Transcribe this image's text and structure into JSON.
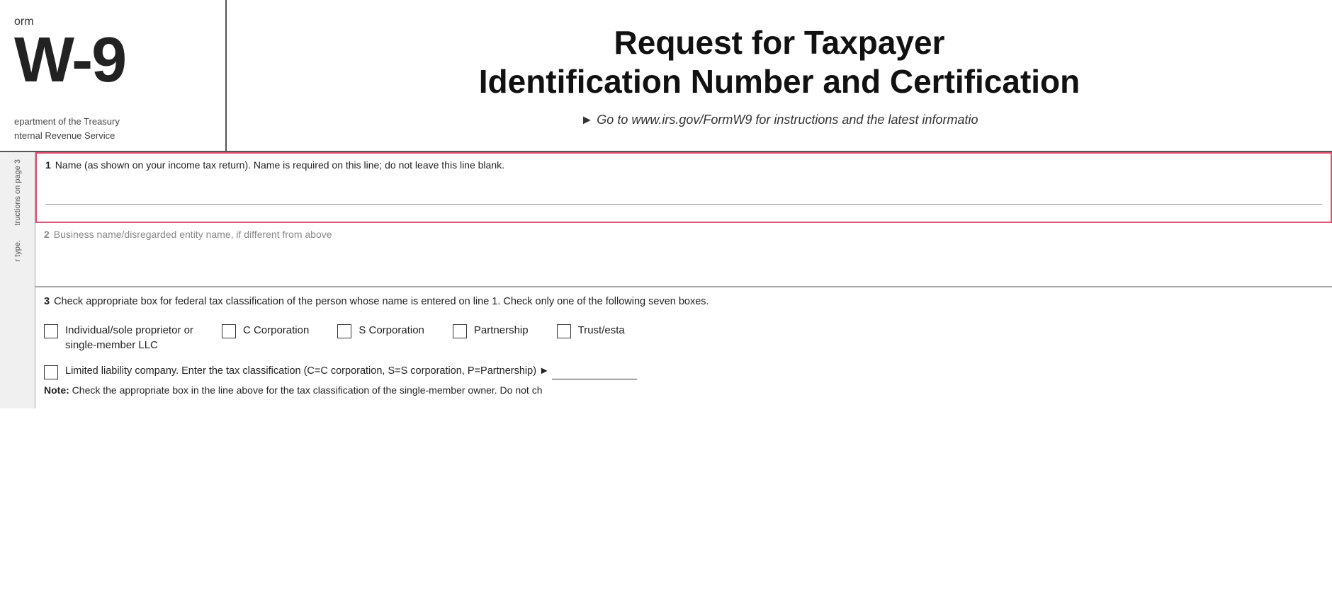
{
  "header": {
    "form_number": "W-9",
    "form_label": "orm",
    "dept_line1": "epartment of the Treasury",
    "dept_line2": "nternal Revenue Service",
    "title_line1": "Request for Taxpayer",
    "title_line2": "Identification Number and Certification",
    "url_text": "► Go to www.irs.gov/FormW9 for instructions and the latest informatio"
  },
  "sidebar": {
    "line1": "r type.",
    "line2": "tructions on page 3"
  },
  "field1": {
    "number": "1",
    "label": "Name (as shown on your income tax return). Name is required on this line; do not leave this line blank."
  },
  "field2": {
    "number": "2",
    "label": "Business name/disregarded entity name, if different from above"
  },
  "field3": {
    "number": "3",
    "header": "Check appropriate box for federal tax classification of the person whose name is entered on line 1. Check only one of the following seven boxes.",
    "checkbox1_label": "Individual/sole proprietor or\nsingle-member LLC",
    "checkbox2_label": "C Corporation",
    "checkbox3_label": "S Corporation",
    "checkbox4_label": "Partnership",
    "checkbox5_label": "Trust/esta",
    "llc_label": "Limited liability company. Enter the tax classification (C=C corporation, S=S corporation, P=Partnership) ►",
    "note_label": "Note:",
    "note_text": "Check the appropriate box in the line above for the tax classification of the single-member owner.  Do not ch"
  }
}
